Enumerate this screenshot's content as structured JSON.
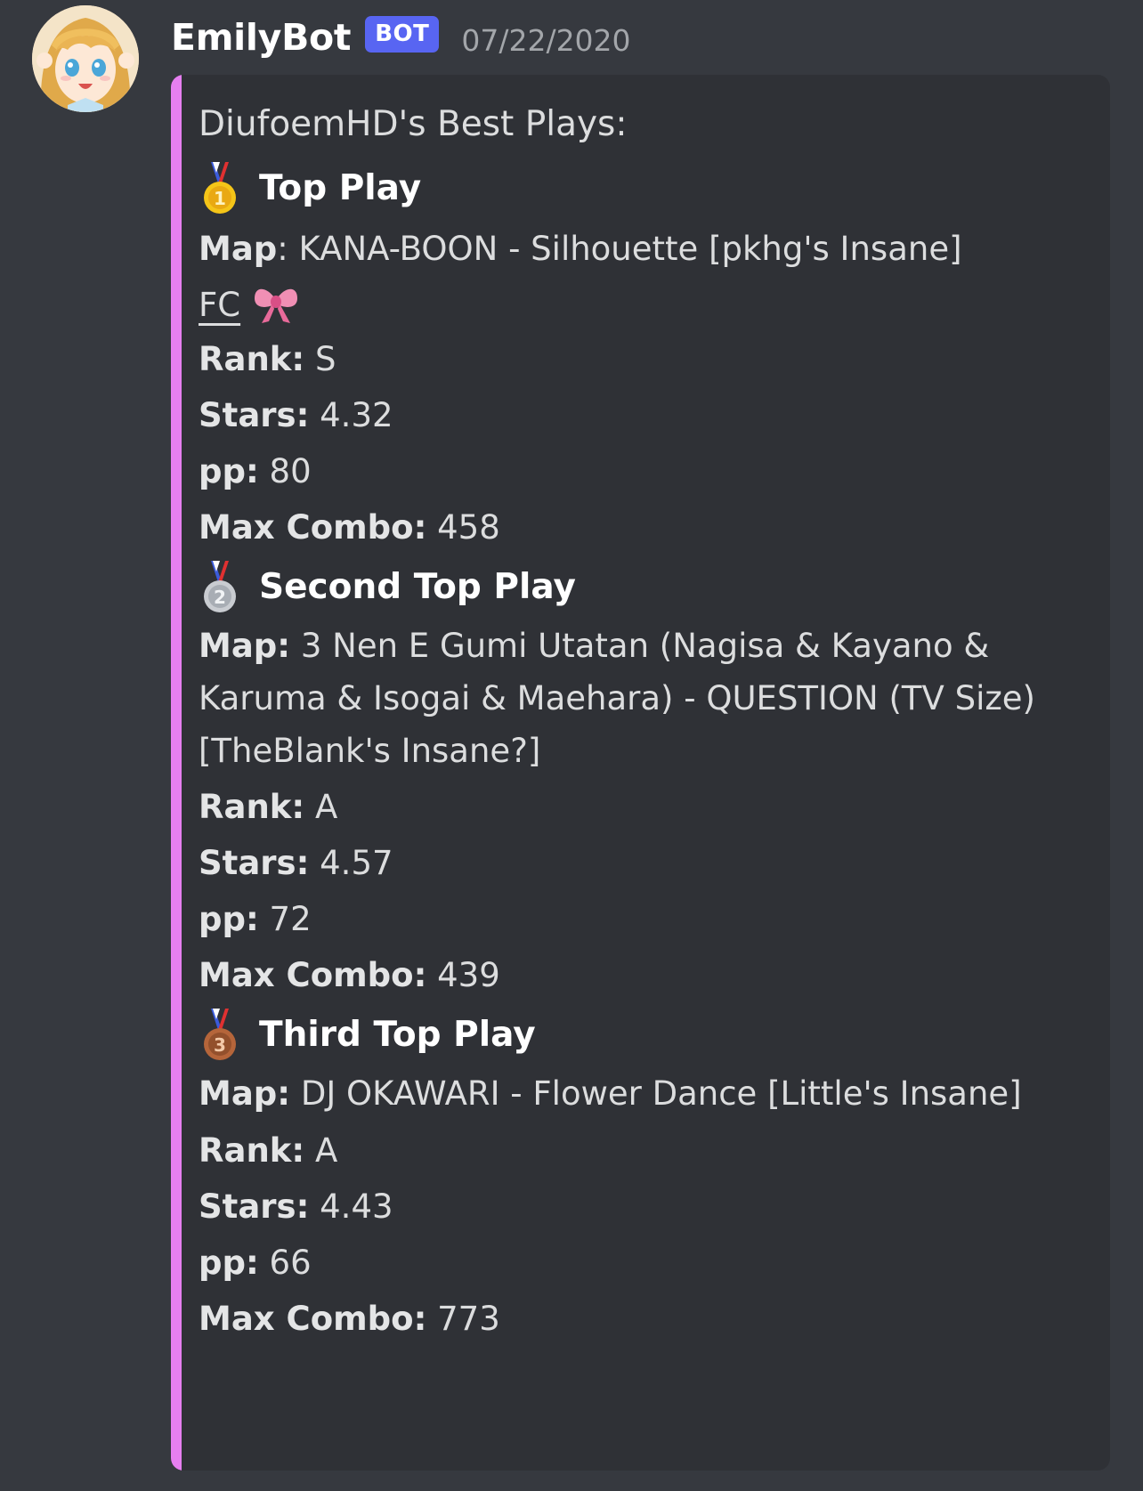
{
  "message": {
    "username": "EmilyBot",
    "bot_tag": "BOT",
    "timestamp": "07/22/2020",
    "avatar_icon": "anime-girl-avatar-icon"
  },
  "embed": {
    "accent_color": "#e67ff0",
    "title": "DiufoemHD's Best Plays:",
    "plays": [
      {
        "medal_icon": "first-place-medal-icon",
        "heading": "Top Play",
        "map_label": "Map",
        "map_value": "KANA-BOON - Silhouette [pkhg's Insane]",
        "fc_label": "FC",
        "fc_icon": "ribbon-icon",
        "rank_label": "Rank:",
        "rank_value": "S",
        "stars_label": "Stars:",
        "stars_value": "4.32",
        "pp_label": "pp:",
        "pp_value": "80",
        "combo_label": "Max Combo:",
        "combo_value": "458"
      },
      {
        "medal_icon": "second-place-medal-icon",
        "heading": "Second Top Play",
        "map_label": "Map:",
        "map_value": "3 Nen E Gumi Utatan (Nagisa & Kayano & Karuma & Isogai & Maehara) - QUESTION (TV Size) [TheBlank's Insane?]",
        "rank_label": "Rank:",
        "rank_value": "A",
        "stars_label": "Stars:",
        "stars_value": "4.57",
        "pp_label": "pp:",
        "pp_value": "72",
        "combo_label": "Max Combo:",
        "combo_value": "439"
      },
      {
        "medal_icon": "third-place-medal-icon",
        "heading": "Third Top Play",
        "map_label": "Map:",
        "map_value": "DJ OKAWARI - Flower Dance [Little's Insane]",
        "rank_label": "Rank:",
        "rank_value": "A",
        "stars_label": "Stars:",
        "stars_value": "4.43",
        "pp_label": "pp:",
        "pp_value": "66",
        "combo_label": "Max Combo:",
        "combo_value": "773"
      }
    ]
  },
  "colors": {
    "background": "#36393f",
    "embed_background": "#2f3136",
    "bot_tag": "#5865f2",
    "timestamp": "#a3a6aa",
    "text": "#dcddde"
  }
}
